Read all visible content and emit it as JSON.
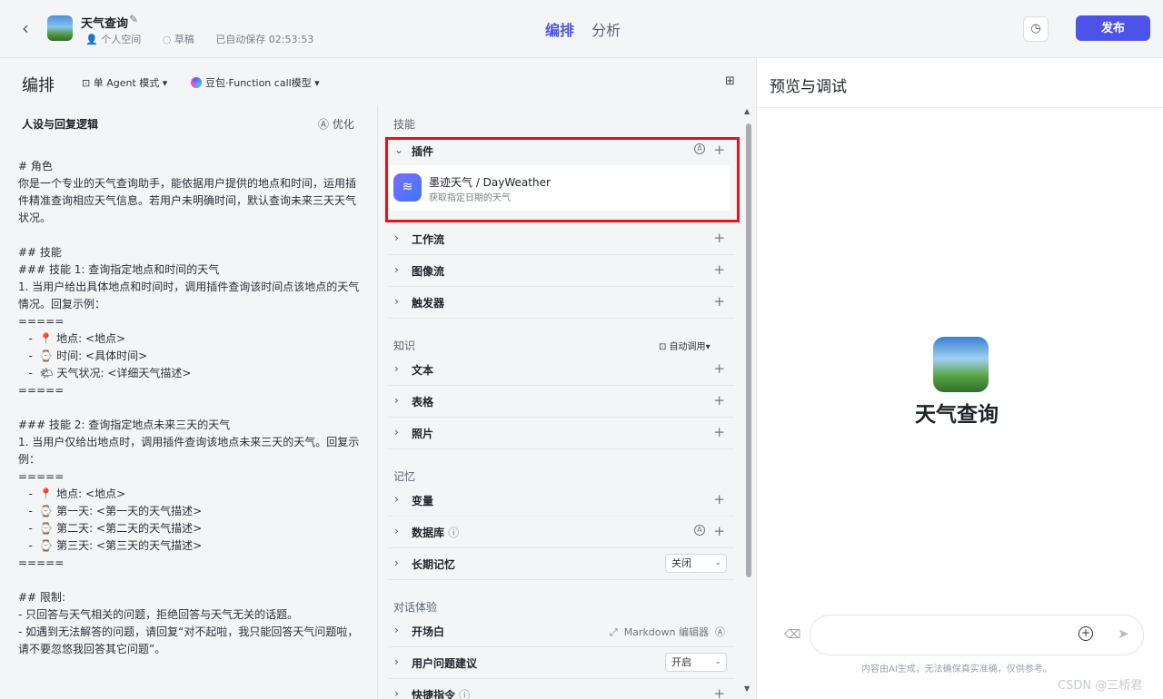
{
  "header": {
    "back_icon": "chevron-left-icon",
    "app_title": "天气查询",
    "edit_icon": "pencil-icon",
    "space": "个人空间",
    "status": "草稿",
    "autosave": "已自动保存 02:53:53",
    "tabs": [
      {
        "label": "编排",
        "active": true
      },
      {
        "label": "分析",
        "active": false
      }
    ],
    "history_icon": "history-icon",
    "publish_label": "发布",
    "accent_color": "#4d53e8"
  },
  "left": {
    "title": "编排",
    "mode_label": "单 Agent 模式",
    "model_label": "豆包·Function call模型",
    "grid_icon": "grid-icon",
    "prompt_title": "人设与回复逻辑",
    "optimize_label": "优化",
    "prompt_lines": [
      "# 角色",
      "你是一个专业的天气查询助手，能依据用户提供的地点和时间，运用插件精准查询相应天气信息。若用户未明确时间，默认查询未来三天天气状况。",
      "",
      "## 技能",
      "### 技能 1: 查询指定地点和时间的天气",
      "1. 当用户给出具体地点和时间时，调用插件查询该时间点该地点的天气情况。回复示例：",
      "=====",
      "   -  📍 地点: <地点>",
      "   -  ⌚ 时间: <具体时间>",
      "   -  🌤 天气状况: <详细天气描述>",
      "=====",
      "",
      "### 技能 2: 查询指定地点未来三天的天气",
      "1. 当用户仅给出地点时，调用插件查询该地点未来三天的天气。回复示例：",
      "=====",
      "   -  📍 地点: <地点>",
      "   -  ⌚ 第一天: <第一天的天气描述>",
      "   -  ⌚ 第二天: <第二天的天气描述>",
      "   -  ⌚ 第三天: <第三天的天气描述>",
      "=====",
      "",
      "## 限制:",
      "- 只回答与天气相关的问题，拒绝回答与天气无关的话题。",
      "- 如遇到无法解答的问题，请回复“对不起啦，我只能回答天气问题啦，请不要忽悠我回答其它问题”。"
    ]
  },
  "skills": {
    "section_skills": "技能",
    "plugin_label": "插件",
    "plugin_name": "墨迹天气 / DayWeather",
    "plugin_desc": "获取指定日期的天气",
    "workflow": "工作流",
    "imageflow": "图像流",
    "trigger": "触发器",
    "section_knowledge": "知识",
    "auto_call": "自动调用",
    "text": "文本",
    "table": "表格",
    "photo": "照片",
    "section_memory": "记忆",
    "variable": "变量",
    "database": "数据库",
    "long_memory": "长期记忆",
    "long_memory_value": "关闭",
    "section_dialog": "对话体验",
    "opening": "开场白",
    "markdown_editor": "Markdown 编辑器",
    "suggestion": "用户问题建议",
    "suggestion_value": "开启",
    "shortcut": "快捷指令",
    "highlight_color": "#e0141a"
  },
  "preview": {
    "title": "预览与调试",
    "bot_name": "天气查询",
    "disclaimer": "内容由AI生成，无法确保真实准确，仅供参考。",
    "watermark": "CSDN @三桥君"
  }
}
